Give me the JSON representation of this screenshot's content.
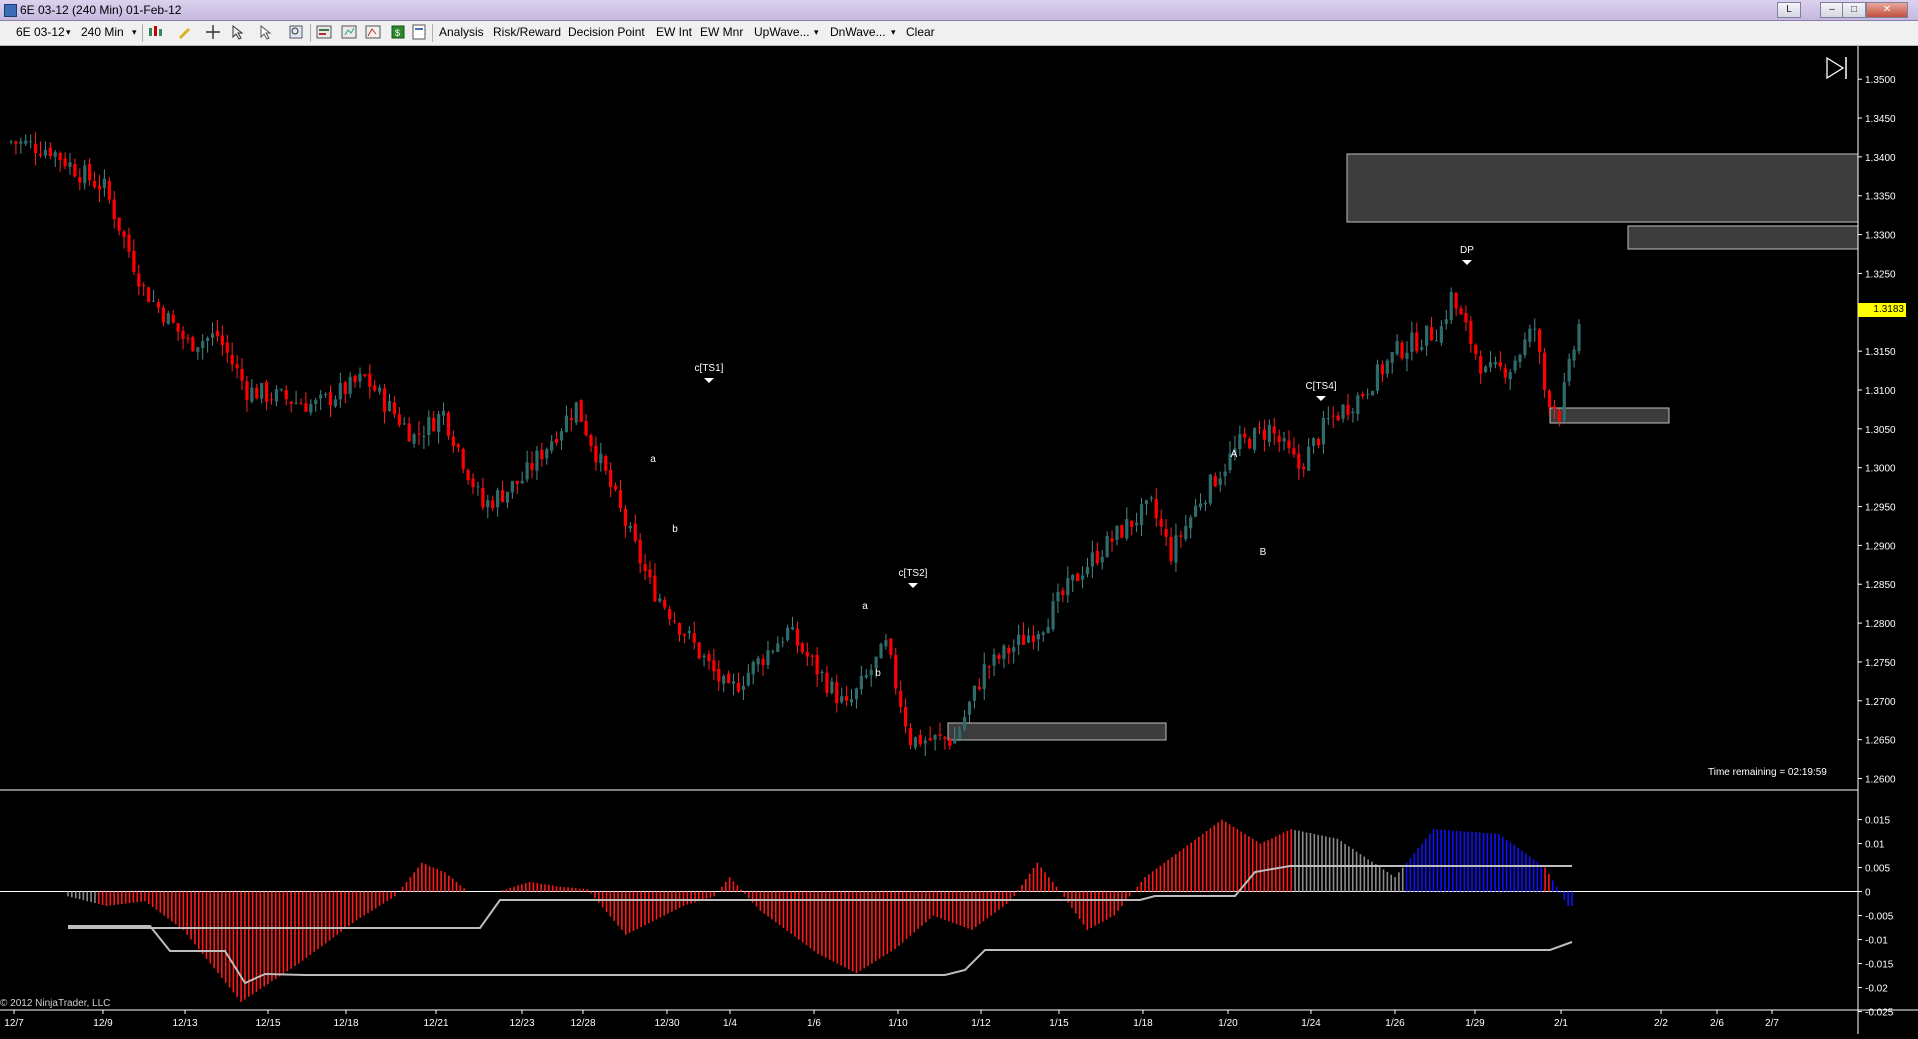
{
  "window": {
    "title": "6E 03-12 (240 Min)  01-Feb-12",
    "btn_l": "L",
    "btn_min": "–",
    "btn_max": "□",
    "btn_close": "✕"
  },
  "toolbar": {
    "instrument": "6E 03-12",
    "interval": "240 Min",
    "menus": [
      "Analysis",
      "Risk/Reward",
      "Decision Point",
      "EW Int",
      "EW Mnr",
      "UpWave...",
      "DnWave...",
      "Clear"
    ]
  },
  "price_axis": [
    "1.3500",
    "1.3450",
    "1.3400",
    "1.3350",
    "1.3300",
    "1.3250",
    "1.3200",
    "1.3150",
    "1.3100",
    "1.3050",
    "1.3000",
    "1.2950",
    "1.2900",
    "1.2850",
    "1.2800",
    "1.2750",
    "1.2700",
    "1.2650",
    "1.2600"
  ],
  "indicator_axis": [
    "0.015",
    "0.01",
    "0.005",
    "0",
    "-0.005",
    "-0.01",
    "-0.015",
    "-0.02",
    "-0.025"
  ],
  "date_axis": [
    "12/7",
    "12/9",
    "12/13",
    "12/15",
    "12/18",
    "12/21",
    "12/23",
    "12/28",
    "12/30",
    "1/4",
    "1/6",
    "1/10",
    "1/12",
    "1/15",
    "1/18",
    "1/20",
    "1/24",
    "1/26",
    "1/29",
    "2/1",
    "2/2",
    "2/6",
    "2/7"
  ],
  "annotations": [
    "c[TS1]",
    "a",
    "b",
    "c[TS2]",
    "a",
    "b",
    "A",
    "B",
    "C[TS4]",
    "DP"
  ],
  "last_price": "1.3183",
  "time_remaining": "Time remaining = 02:19:59",
  "copyright": "© 2012 NinjaTrader, LLC",
  "colors": {
    "background": "#000000",
    "up_candle": "#2e6b6b",
    "down_candle": "#ff0000",
    "hist_red": "#ff1a1a",
    "hist_gray": "#8c8c8c",
    "hist_blue": "#1010ff",
    "zone": "#3c3c3c",
    "last_price_tag": "#ffff00"
  },
  "icons": [
    "bar-type-icon",
    "pencil-icon",
    "crosshair-icon",
    "zoom-icon",
    "properties-icon",
    "data-box-icon",
    "strategy-icon",
    "template-icon"
  ],
  "chart_data": {
    "type": "candlestick",
    "instrument": "6E 03-12",
    "interval": "240 Min",
    "ylim": [
      1.2575,
      1.3535
    ],
    "candles": [],
    "indicator": {
      "ylim": [
        -0.0265,
        0.0172
      ],
      "histogram": [],
      "upper_band_level": 0.0125,
      "lower_band_level": -0.019
    }
  }
}
